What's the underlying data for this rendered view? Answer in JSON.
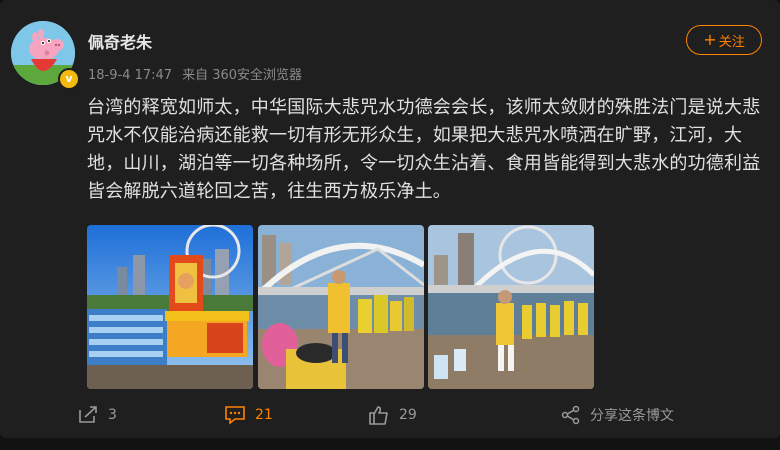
{
  "post": {
    "author": "佩奇老朱",
    "timestamp": "18-9-4 17:47",
    "source": "来自 360安全浏览器",
    "follow_label": "关注",
    "follow_plus": "+",
    "text": "台湾的释宽如师太，中华国际大悲咒水功德会会长，该师太敛财的殊胜法门是说大悲咒水不仅能治病还能救一切有形无形众生，如果把大悲咒水喷洒在旷野，江河，大地，山川，湖泊等一切各种场所，令一切众生沾着、食用皆能得到大悲水的功德利益皆会解脱六道轮回之苦，往生西方极乐净土。",
    "verified_badge": "v"
  },
  "actions": {
    "repost_count": "3",
    "comment_count": "21",
    "like_count": "29",
    "share_label": "分享这条博文"
  },
  "colors": {
    "accent": "#ff8200",
    "background": "#1f1f1f",
    "text": "#e0e0e0",
    "muted": "#8a8a8a"
  },
  "icons": [
    "repost-icon",
    "comment-icon",
    "like-icon",
    "share-icon",
    "verified-badge-icon"
  ]
}
